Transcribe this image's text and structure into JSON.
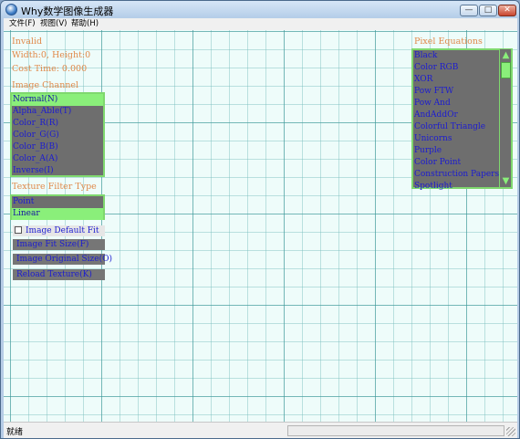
{
  "window": {
    "title": "Why数学图像生成器",
    "minimize_glyph": "—",
    "maximize_glyph": "□",
    "close_glyph": "✕"
  },
  "menu": [
    "文件(F)",
    "视图(V)",
    "帮助(H)"
  ],
  "info": {
    "status": "Invalid",
    "size": "Width:0, Height:0",
    "cost_time": "Cost Time: 0.000"
  },
  "image_channel": {
    "title": "Image Channel",
    "items": [
      "Normal(N)",
      "Alpha_Able(T)",
      "Color_R(R)",
      "Color_G(G)",
      "Color_B(B)",
      "Color_A(A)",
      "Inverse(I)"
    ],
    "selected": "Normal(N)"
  },
  "texture_filter": {
    "title": "Texture Filter Type",
    "items": [
      "Point",
      "Linear"
    ],
    "selected": "Linear"
  },
  "checkbox": {
    "label": "Image Default Fit",
    "checked": false
  },
  "buttons": {
    "fit_size": "Image Fit Size(F)",
    "original_size": "Image Original Size(O)",
    "reload": "Reload Texture(K)"
  },
  "pixel_equations": {
    "title": "Pixel Equations",
    "items": [
      "Black",
      "Color RGB",
      "XOR",
      "Pow FTW",
      "Pow And",
      "AndAddOr",
      "Colorful Triangle",
      "Unicorns",
      "Purple",
      "Color Point",
      "Construction Papers",
      "Spotlight"
    ],
    "scroll_up": "▲",
    "scroll_down": "▼"
  },
  "statusbar": {
    "text": "就绪"
  },
  "colors": {
    "grid": "#3c9696",
    "canvas": "#eefcfa",
    "list_bg": "#6e6e6e",
    "highlight": "#8aef7a",
    "item_text": "#1c1cd0",
    "label_text": "#e0894a"
  }
}
